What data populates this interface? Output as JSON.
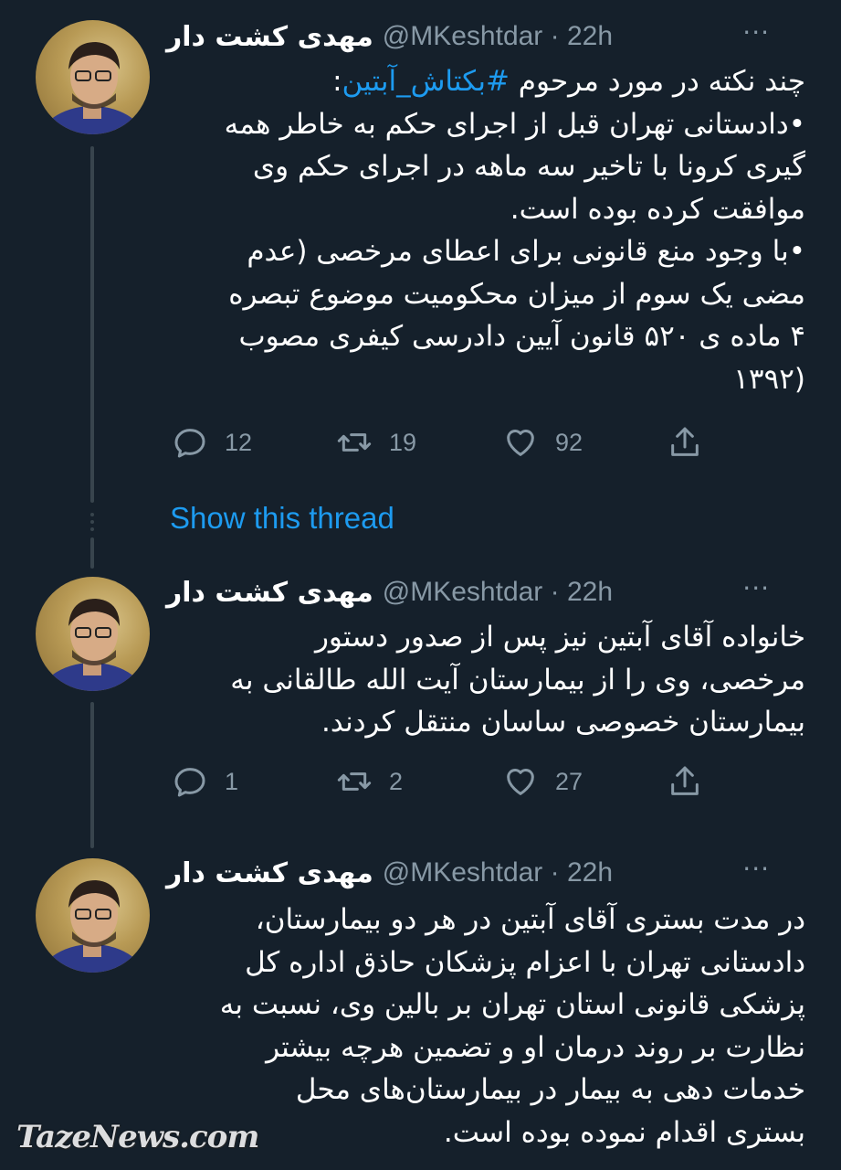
{
  "tweets": [
    {
      "name": "مهدی کشت دار",
      "handle": "@MKeshtdar · 22h",
      "more": "···",
      "lines_pre": "چند نکته در مورد مرحوم ",
      "hashtag": "#بکتاش_آبتین",
      "lines_post": ":",
      "lines": [
        "•دادستانی تهران قبل از اجرای حکم به خاطر همه",
        "گیری کرونا با تاخیر سه ماهه در اجرای حکم وی",
        "موافقت کرده بوده است.",
        "•با وجود منع قانونی برای اعطای مرخصی (عدم",
        "مضی یک سوم از میزان محکومیت موضوع تبصره",
        "۴ ماده ی ۵۲۰ قانون آیین دادرسی کیفری مصوب",
        "(۱۳۹۲"
      ],
      "replies": "12",
      "retweets": "19",
      "likes": "92"
    },
    {
      "name": "مهدی کشت دار",
      "handle": "@MKeshtdar · 22h",
      "more": "···",
      "lines": [
        "خانواده آقای آبتین نیز پس از صدور دستور",
        "مرخصی، وی را از بیمارستان آیت الله طالقانی به",
        "بیمارستان خصوصی ساسان منتقل کردند."
      ],
      "replies": "1",
      "retweets": "2",
      "likes": "27"
    },
    {
      "name": "مهدی کشت دار",
      "handle": "@MKeshtdar · 22h",
      "more": "···",
      "lines": [
        "در مدت بستری آقای آبتین در هر دو بیمارستان،",
        "دادستانی تهران با اعزام پزشکان حاذق اداره کل",
        "پزشکی قانونی استان تهران بر بالین وی، نسبت به",
        "نظارت بر روند درمان او و تضمین هرچه بیشتر",
        "خدمات دهی به بیمار در بیمارستان‌های محل",
        "بستری اقدام نموده بوده است."
      ]
    }
  ],
  "show_thread": "Show this thread",
  "watermark": "TazeNews.com",
  "colors": {
    "background": "#15202b",
    "link": "#1d9bf0",
    "muted": "#8899a6"
  }
}
